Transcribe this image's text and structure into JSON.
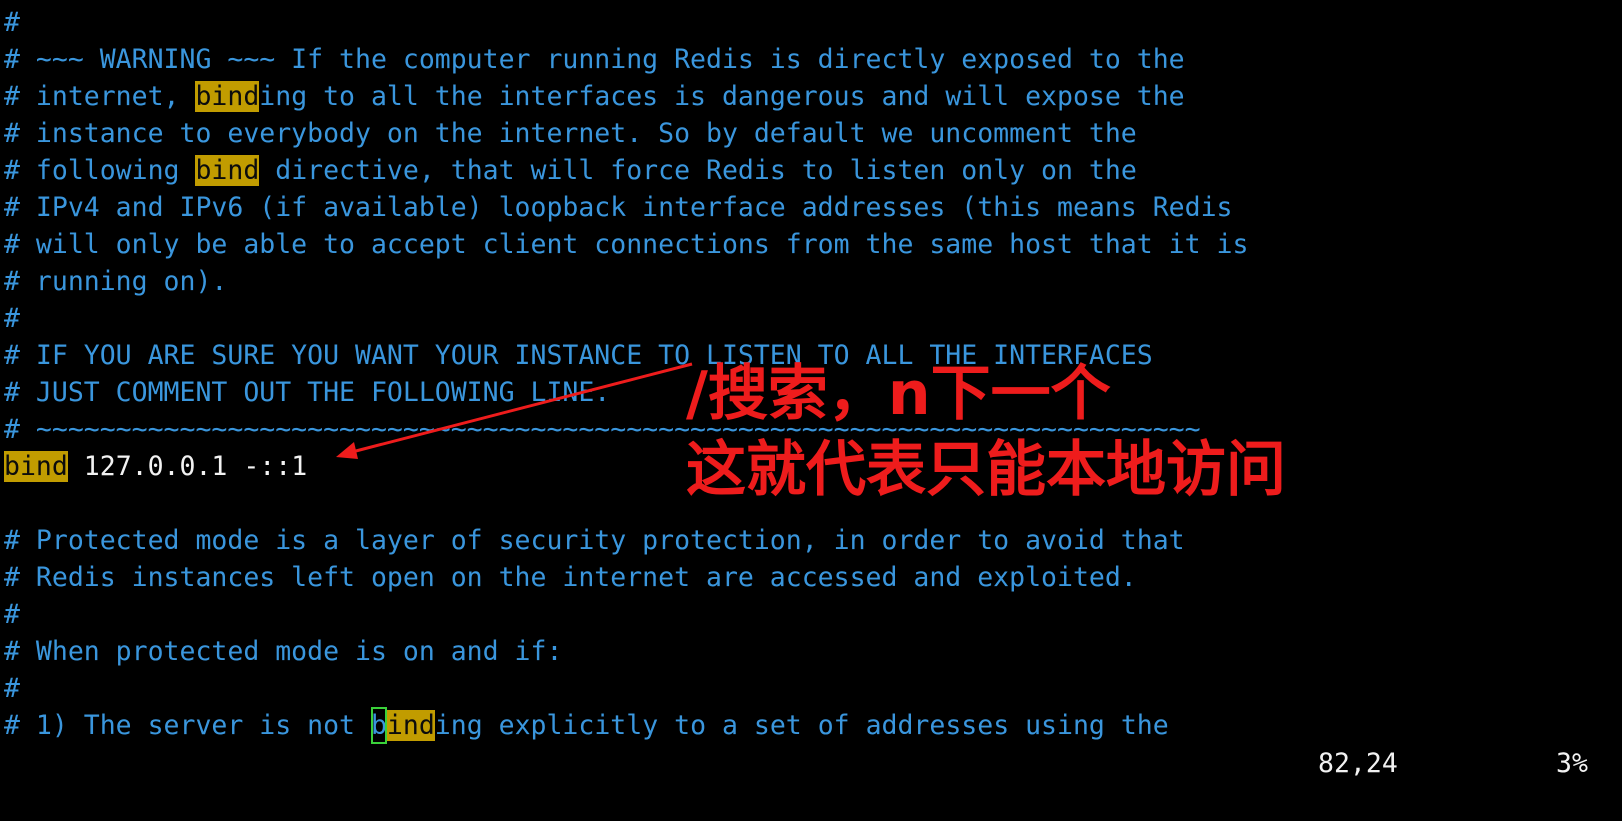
{
  "editor": {
    "lines": [
      [
        {
          "text": "#",
          "style": "comment"
        }
      ],
      [
        {
          "text": "# ~~~ WARNING ~~~ If the computer running Redis is directly exposed to the",
          "style": "comment"
        }
      ],
      [
        {
          "text": "# internet, ",
          "style": "comment"
        },
        {
          "text": "bind",
          "style": "hl"
        },
        {
          "text": "ing to all the interfaces is dangerous and will expose the",
          "style": "comment"
        }
      ],
      [
        {
          "text": "# instance to everybody on the internet. So by default we uncomment the",
          "style": "comment"
        }
      ],
      [
        {
          "text": "# following ",
          "style": "comment"
        },
        {
          "text": "bind",
          "style": "hl"
        },
        {
          "text": " directive, that will force Redis to listen only on the",
          "style": "comment"
        }
      ],
      [
        {
          "text": "# IPv4 and IPv6 (if available) loopback interface addresses (this means Redis",
          "style": "comment"
        }
      ],
      [
        {
          "text": "# will only be able to accept client connections from the same host that it is",
          "style": "comment"
        }
      ],
      [
        {
          "text": "# running on).",
          "style": "comment"
        }
      ],
      [
        {
          "text": "#",
          "style": "comment"
        }
      ],
      [
        {
          "text": "# IF YOU ARE SURE YOU WANT YOUR INSTANCE TO LISTEN TO ALL THE INTERFACES",
          "style": "comment"
        }
      ],
      [
        {
          "text": "# JUST COMMENT OUT THE FOLLOWING LINE.",
          "style": "comment"
        }
      ],
      [
        {
          "text": "# ~~~~~~~~~~~~~~~~~~~~~~~~~~~~~~~~~~~~~~~~~~~~~~~~~~~~~~~~~~~~~~~~~~~~~~~~~",
          "style": "comment"
        }
      ],
      [
        {
          "text": "bind",
          "style": "hl"
        },
        {
          "text": " 127.0.0.1 -::1",
          "style": "white"
        }
      ],
      [
        {
          "text": "",
          "style": "comment"
        }
      ],
      [
        {
          "text": "# Protected mode is a layer of security protection, in order to avoid that",
          "style": "comment"
        }
      ],
      [
        {
          "text": "# Redis instances left open on the internet are accessed and exploited.",
          "style": "comment"
        }
      ],
      [
        {
          "text": "#",
          "style": "comment"
        }
      ],
      [
        {
          "text": "# When protected mode is on and if:",
          "style": "comment"
        }
      ],
      [
        {
          "text": "#",
          "style": "comment"
        }
      ],
      [
        {
          "text": "# 1) The server is not ",
          "style": "comment"
        },
        {
          "text": "b",
          "style": "cursor"
        },
        {
          "text": "ind",
          "style": "hl"
        },
        {
          "text": "ing explicitly to a set of addresses using the",
          "style": "comment"
        }
      ]
    ]
  },
  "status_bar": {
    "cursor_position": "82,24",
    "scroll_percent": "3%"
  },
  "annotation": {
    "line1": "/搜索，n下一个",
    "line2": "这就代表只能本地访问",
    "color": "#ee1c1c"
  },
  "colors": {
    "background": "#000000",
    "comment": "#3a96dd",
    "highlight_bg": "#c19c00",
    "cursor_outline": "#3ad13a",
    "text": "#f2f2f2"
  }
}
